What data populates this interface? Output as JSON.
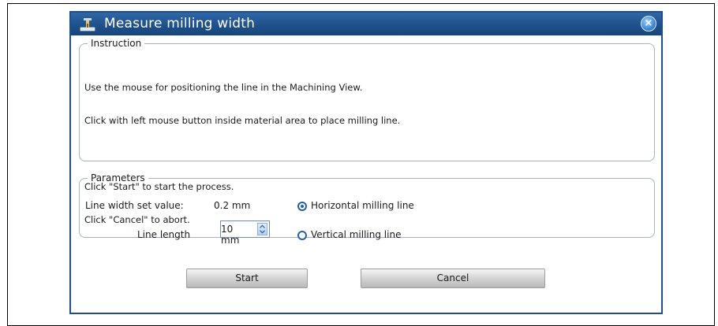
{
  "dialog": {
    "title": "Measure milling width",
    "close_label": "×",
    "icon": "milling-machine-icon"
  },
  "instruction": {
    "legend": "Instruction",
    "lines": [
      "Use the mouse for positioning the line in the Machining View.",
      "Click with left mouse button inside material area to place milling line.",
      "",
      "Click \"Start\" to start the process.",
      "Click \"Cancel\" to abort."
    ]
  },
  "parameters": {
    "legend": "Parameters",
    "line_width_label": "Line width set value:",
    "line_width_value": "0.2 mm",
    "line_length_label": "Line length",
    "line_length_value": "10 mm",
    "radio_horizontal": "Horizontal milling line",
    "radio_vertical": "Vertical milling line",
    "selected": "horizontal"
  },
  "buttons": {
    "start": "Start",
    "cancel": "Cancel"
  },
  "colors": {
    "title_bar": "#1d4f8a",
    "accent": "#1f5fb2"
  }
}
